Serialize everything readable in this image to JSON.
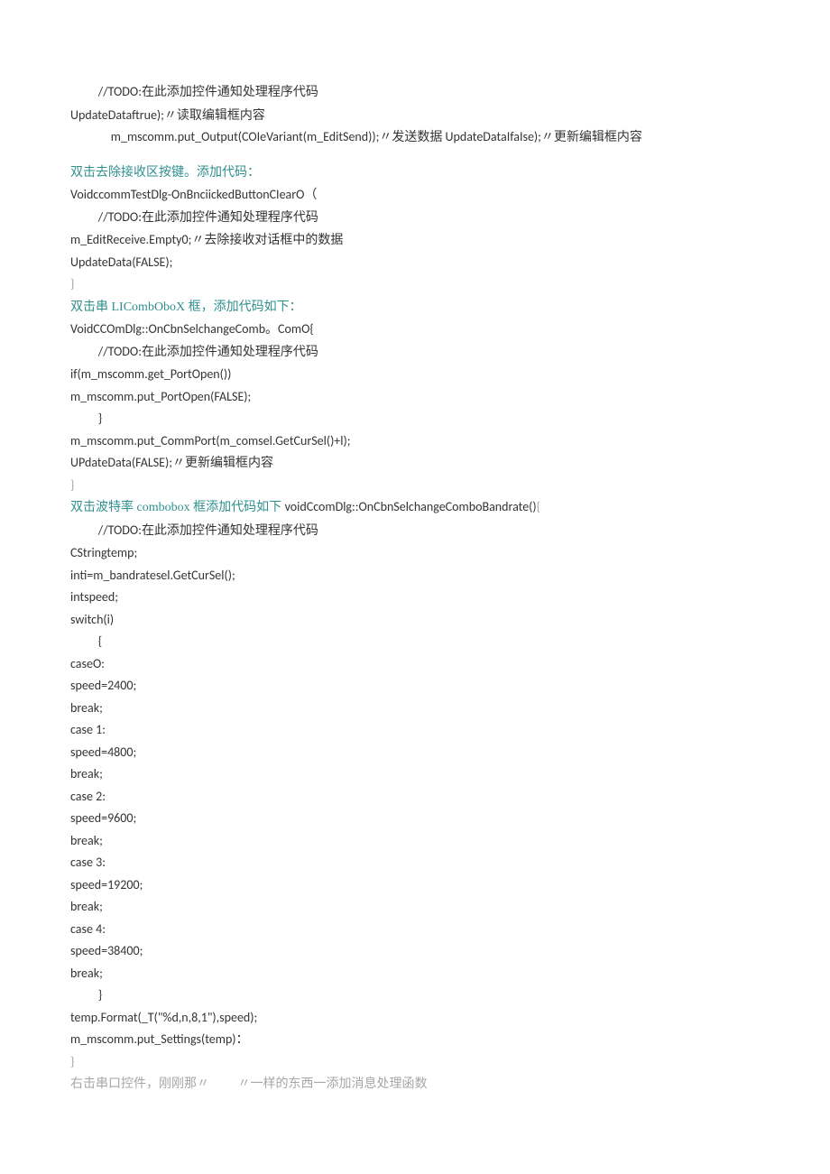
{
  "lines": [
    {
      "cls": "line indent1",
      "parts": [
        {
          "text": "//TODO:",
          "cls": "body-text"
        },
        {
          "text": "在此添加控件通知处理程序代码",
          "cls": "cn body-text"
        }
      ]
    },
    {
      "cls": "line",
      "parts": [
        {
          "text": "UpdateDataftrue);〃读取编辑框内容",
          "cls": "body-text"
        }
      ]
    },
    {
      "cls": "line indent2",
      "parts": [
        {
          "text": "m_mscomm.put_Output(COIeVariant(m_EditSend));〃发送数据 UpdateDataIfaIse);〃更新编辑框内容",
          "cls": "body-text"
        }
      ]
    },
    {
      "cls": "spacer"
    },
    {
      "cls": "line",
      "parts": [
        {
          "text": "双击去除接收区按键。添加代码：",
          "cls": "teal cn"
        }
      ]
    },
    {
      "cls": "line",
      "parts": [
        {
          "text": "VoidccommTestDlg-OnBnciickedButtonCIearO（",
          "cls": "body-text"
        }
      ]
    },
    {
      "cls": "line indent1",
      "parts": [
        {
          "text": "//TODO:",
          "cls": "body-text"
        },
        {
          "text": "在此添加控件通知处理程序代码",
          "cls": "cn body-text"
        }
      ]
    },
    {
      "cls": "line",
      "parts": [
        {
          "text": "m_EditReceive.Empty0;〃去除接收对话框中的数据",
          "cls": "body-text"
        }
      ]
    },
    {
      "cls": "line",
      "parts": [
        {
          "text": "UpdateData(FALSE);",
          "cls": "body-text"
        }
      ]
    },
    {
      "cls": "line",
      "parts": [
        {
          "text": "}",
          "cls": "gray"
        }
      ]
    },
    {
      "cls": "line",
      "parts": [
        {
          "text": "双击串 LICombOboX 框，添加代码如下：",
          "cls": "teal cn"
        }
      ]
    },
    {
      "cls": "line",
      "parts": [
        {
          "text": "VoidCCOmDlg::OnCbnSelchangeComb。ComO{",
          "cls": "body-text"
        }
      ]
    },
    {
      "cls": "line indent1",
      "parts": [
        {
          "text": "//TODO:",
          "cls": "body-text"
        },
        {
          "text": "在此添加控件通知处理程序代码",
          "cls": "cn body-text"
        }
      ]
    },
    {
      "cls": "line",
      "parts": [
        {
          "text": "if(m_mscomm.get_PortOpen())",
          "cls": "body-text"
        }
      ]
    },
    {
      "cls": "line",
      "parts": [
        {
          "text": "m_mscomm.put_PortOpen(FALSE);",
          "cls": "body-text"
        }
      ]
    },
    {
      "cls": "line indent1",
      "parts": [
        {
          "text": "}",
          "cls": "body-text"
        }
      ]
    },
    {
      "cls": "line",
      "parts": [
        {
          "text": "m_mscomm.put_CommPort(m_comsel.GetCurSel()+l);",
          "cls": "body-text"
        }
      ]
    },
    {
      "cls": "line",
      "parts": [
        {
          "text": "UPdateData(FALSE);〃更新编辑框内容",
          "cls": "body-text"
        }
      ]
    },
    {
      "cls": "line",
      "parts": [
        {
          "text": "}",
          "cls": "gray"
        }
      ]
    },
    {
      "cls": "line",
      "parts": [
        {
          "text": "双击波特率 combobox 框添加代码如下 ",
          "cls": "teal cn"
        },
        {
          "text": "voidCcomDlg::OnCbnSelchangeComboBandrate()",
          "cls": "body-text"
        },
        {
          "text": "{",
          "cls": "gray"
        }
      ]
    },
    {
      "cls": "line indent1",
      "parts": [
        {
          "text": "//TODO:",
          "cls": "body-text"
        },
        {
          "text": "在此添加控件通知处理程序代码",
          "cls": "cn body-text"
        }
      ]
    },
    {
      "cls": "line",
      "parts": [
        {
          "text": "CStringtemp;",
          "cls": "body-text"
        }
      ]
    },
    {
      "cls": "line",
      "parts": [
        {
          "text": "inti=m_bandratesel.GetCurSel();",
          "cls": "body-text"
        }
      ]
    },
    {
      "cls": "line",
      "parts": [
        {
          "text": "intspeed;",
          "cls": "body-text"
        }
      ]
    },
    {
      "cls": "line",
      "parts": [
        {
          "text": "switch(i)",
          "cls": "body-text"
        }
      ]
    },
    {
      "cls": "line indent1",
      "parts": [
        {
          "text": "{",
          "cls": "body-text"
        }
      ]
    },
    {
      "cls": "line",
      "parts": [
        {
          "text": "caseO:",
          "cls": "body-text"
        }
      ]
    },
    {
      "cls": "line",
      "parts": [
        {
          "text": "speed=2400;",
          "cls": "body-text"
        }
      ]
    },
    {
      "cls": "line",
      "parts": [
        {
          "text": "break;",
          "cls": "body-text"
        }
      ]
    },
    {
      "cls": "line",
      "parts": [
        {
          "text": "case 1:",
          "cls": "body-text"
        }
      ]
    },
    {
      "cls": "line",
      "parts": [
        {
          "text": "speed=4800;",
          "cls": "body-text"
        }
      ]
    },
    {
      "cls": "line",
      "parts": [
        {
          "text": "break;",
          "cls": "body-text"
        }
      ]
    },
    {
      "cls": "line",
      "parts": [
        {
          "text": "case 2:",
          "cls": "body-text"
        }
      ]
    },
    {
      "cls": "line",
      "parts": [
        {
          "text": "speed=9600;",
          "cls": "body-text"
        }
      ]
    },
    {
      "cls": "line",
      "parts": [
        {
          "text": "break;",
          "cls": "body-text"
        }
      ]
    },
    {
      "cls": "line",
      "parts": [
        {
          "text": "case 3:",
          "cls": "body-text"
        }
      ]
    },
    {
      "cls": "line",
      "parts": [
        {
          "text": "speed=19200;",
          "cls": "body-text"
        }
      ]
    },
    {
      "cls": "line",
      "parts": [
        {
          "text": "break;",
          "cls": "body-text"
        }
      ]
    },
    {
      "cls": "line",
      "parts": [
        {
          "text": "case 4:",
          "cls": "body-text"
        }
      ]
    },
    {
      "cls": "line",
      "parts": [
        {
          "text": "speed=38400;",
          "cls": "body-text"
        }
      ]
    },
    {
      "cls": "line",
      "parts": [
        {
          "text": "break;",
          "cls": "body-text"
        }
      ]
    },
    {
      "cls": "line indent1",
      "parts": [
        {
          "text": "}",
          "cls": "body-text"
        }
      ]
    },
    {
      "cls": "line",
      "parts": [
        {
          "text": "temp.Format(_T(\"%d,n,8,1\"),speed);",
          "cls": "body-text"
        }
      ]
    },
    {
      "cls": "line",
      "parts": [
        {
          "text": "m_mscomm.put_Settings(temp)：",
          "cls": "body-text"
        }
      ]
    },
    {
      "cls": "line",
      "parts": [
        {
          "text": "}",
          "cls": "gray"
        }
      ]
    },
    {
      "cls": "line",
      "parts": [
        {
          "text": "右击串口控件，刚刚那〃         〃一样的东西一添加消息处理函数",
          "cls": "gray cn"
        }
      ]
    }
  ]
}
